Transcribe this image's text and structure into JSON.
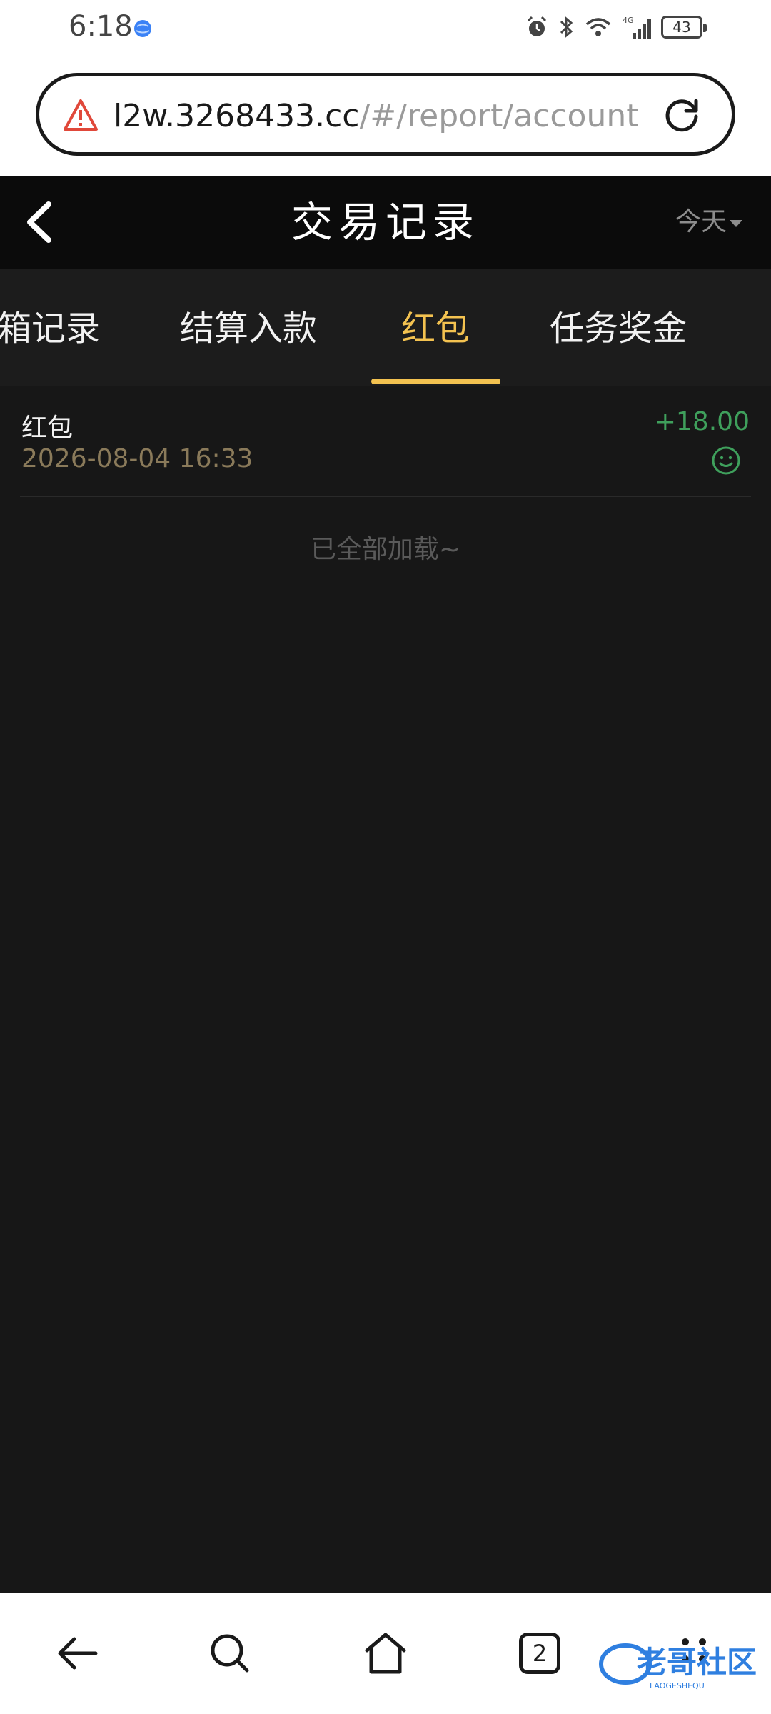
{
  "status_bar": {
    "time": "6:18",
    "network": "4G",
    "battery": "43"
  },
  "browser": {
    "url_host": "l2w.3268433.cc",
    "url_path": "/#/report/account",
    "tab_count": "2"
  },
  "header": {
    "title": "交易记录",
    "date_filter": "今天"
  },
  "tabs": [
    {
      "label": "箱记录",
      "active": false
    },
    {
      "label": "结算入款",
      "active": false
    },
    {
      "label": "红包",
      "active": true
    },
    {
      "label": "任务奖金",
      "active": false
    }
  ],
  "records": [
    {
      "title": "红包",
      "time": "2026-08-04 16:33",
      "amount": "+18.00",
      "status_icon": "smile-icon"
    }
  ],
  "list_end_text": "已全部加载~",
  "watermark": {
    "text": "老哥社区",
    "subtext": "LAOGESHEQU"
  },
  "colors": {
    "accent": "#f3c250",
    "amount_positive": "#3fa05c",
    "background": "#171717",
    "header_bg": "#0b0b0b"
  }
}
